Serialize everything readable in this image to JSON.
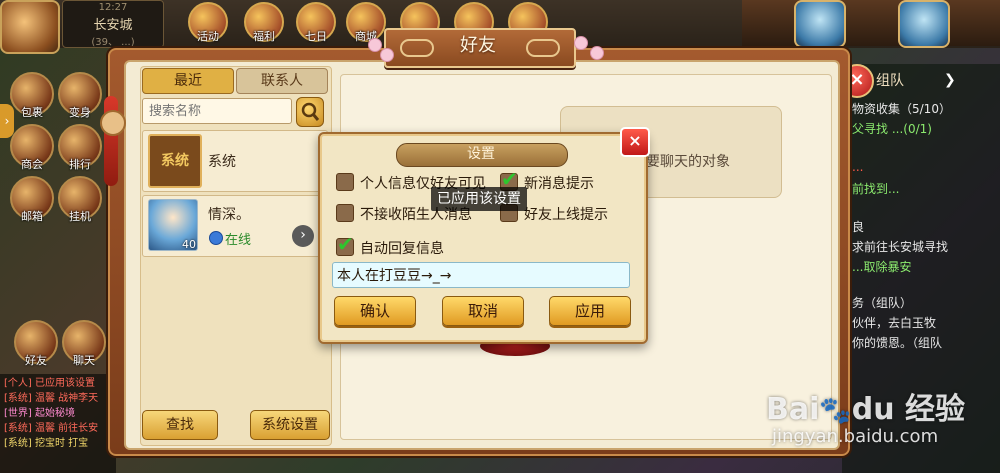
{
  "hud": {
    "time": "12:27",
    "location": "长安城",
    "coords": "(39、 ...)",
    "top_icons": [
      "活动",
      "福利",
      "七日",
      "商城",
      "",
      "",
      ""
    ],
    "left_icons": [
      "包裹",
      "变身",
      "商会",
      "排行",
      "邮箱",
      "挂机",
      "好友",
      "聊天"
    ]
  },
  "background_chat": [
    {
      "text": "[个人] 已应用该设置",
      "color": "red"
    },
    {
      "text": "[系统] 温馨 战神李天",
      "color": "red"
    },
    {
      "text": "[世界] 起始秘境",
      "color": "pink"
    },
    {
      "text": "[系统] 温馨 前往长安",
      "color": "red"
    },
    {
      "text": "[系统] 挖宝时 打宝",
      "color": "yellow"
    }
  ],
  "right_panel": {
    "tab": "组队",
    "lines": [
      {
        "text": "物资收集（5/10）",
        "color": "white"
      },
      {
        "text": "父寻找 ...(0/1)",
        "color": "green"
      },
      {
        "text": "",
        "color": "white"
      },
      {
        "text": "...",
        "color": "red"
      },
      {
        "text": "前找到...",
        "color": "green"
      },
      {
        "text": "",
        "color": "white"
      },
      {
        "text": "良",
        "color": "white"
      },
      {
        "text": "求前往长安城寻找",
        "color": "white"
      },
      {
        "text": "...取除暴安",
        "color": "green"
      },
      {
        "text": "",
        "color": "white"
      },
      {
        "text": "务（组队）",
        "color": "white"
      },
      {
        "text": "伙伴，去白玉牧",
        "color": "white"
      },
      {
        "text": "你的馈恩。（组队",
        "color": "white"
      }
    ]
  },
  "friend_window": {
    "title": "好友",
    "tabs": {
      "recent": "最近",
      "contacts": "联系人"
    },
    "search": {
      "placeholder": "搜索名称"
    },
    "items": {
      "system": {
        "icon_text": "系统",
        "name": "系统"
      },
      "friend": {
        "name": "情深。",
        "level": "40",
        "status": "在线"
      }
    },
    "bottom_buttons": {
      "find": "查找",
      "system_settings": "系统设置"
    },
    "chat_hint": "要聊天的对象"
  },
  "settings_dialog": {
    "title": "设置",
    "close": "×",
    "options": {
      "friends_only_info": {
        "label": "个人信息仅好友可见",
        "checked": false
      },
      "new_msg_tip": {
        "label": "新消息提示",
        "checked": true
      },
      "reject_strangers": {
        "label": "不接收陌生人消息",
        "checked": false
      },
      "friend_online_tip": {
        "label": "好友上线提示",
        "checked": false
      },
      "auto_reply": {
        "label": "自动回复信息",
        "checked": true
      }
    },
    "auto_reply_text": "本人在打豆豆→_→",
    "buttons": {
      "confirm": "确认",
      "cancel": "取消",
      "apply": "应用"
    },
    "toast": "已应用该设置"
  },
  "watermark": {
    "logo": "Bai 度 经验",
    "url": "jingyan.baidu.com"
  },
  "colors": {
    "accent_orange": "#e0a032",
    "check_green": "#2ec52e",
    "close_red": "#d02020"
  }
}
